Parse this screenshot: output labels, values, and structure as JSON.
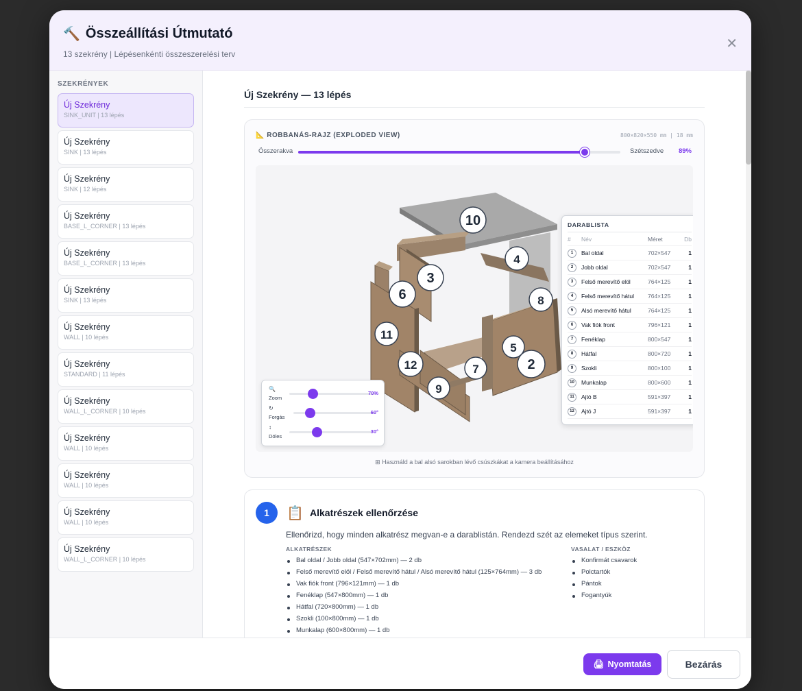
{
  "modal": {
    "title": "Összeállítási Útmutató",
    "subtitle": "13 szekrény | Lépésenkénti összeszerelési terv",
    "close_glyph": "✕"
  },
  "sidebar": {
    "title": "SZEKRÉNYEK",
    "items": [
      {
        "name": "Új Szekrény",
        "meta": "SINK_UNIT | 13 lépés"
      },
      {
        "name": "Új Szekrény",
        "meta": "SINK | 13 lépés"
      },
      {
        "name": "Új Szekrény",
        "meta": "SINK | 12 lépés"
      },
      {
        "name": "Új Szekrény",
        "meta": "BASE_L_CORNER | 13 lépés"
      },
      {
        "name": "Új Szekrény",
        "meta": "BASE_L_CORNER | 13 lépés"
      },
      {
        "name": "Új Szekrény",
        "meta": "SINK | 13 lépés"
      },
      {
        "name": "Új Szekrény",
        "meta": "WALL | 10 lépés"
      },
      {
        "name": "Új Szekrény",
        "meta": "STANDARD | 11 lépés"
      },
      {
        "name": "Új Szekrény",
        "meta": "WALL_L_CORNER | 10 lépés"
      },
      {
        "name": "Új Szekrény",
        "meta": "WALL | 10 lépés"
      },
      {
        "name": "Új Szekrény",
        "meta": "WALL | 10 lépés"
      },
      {
        "name": "Új Szekrény",
        "meta": "WALL | 10 lépés"
      },
      {
        "name": "Új Szekrény",
        "meta": "WALL_L_CORNER | 10 lépés"
      }
    ]
  },
  "main": {
    "heading": "Új Szekrény — 13 lépés",
    "viewer": {
      "title": "ROBBANÁS-RAJZ (EXPLODED VIEW)",
      "dims": "800×820×550 mm | 18 mm",
      "left_label": "Összerakva",
      "right_label": "Szétszedve",
      "explode_value": "89%",
      "explode_fraction": 0.89,
      "hint": "Használd a bal alsó sarokban lévő csúszkákat a kamera beállításához",
      "bom": {
        "title": "DARABLISTA",
        "headers": {
          "n": "#",
          "name": "Név",
          "size": "Méret",
          "qty": "Db"
        },
        "rows": [
          {
            "n": "1",
            "name": "Bal oldal",
            "size": "702×547",
            "qty": "1"
          },
          {
            "n": "2",
            "name": "Jobb oldal",
            "size": "702×547",
            "qty": "1"
          },
          {
            "n": "3",
            "name": "Felső merevítő elöl",
            "size": "764×125",
            "qty": "1"
          },
          {
            "n": "4",
            "name": "Felső merevítő hátul",
            "size": "764×125",
            "qty": "1"
          },
          {
            "n": "5",
            "name": "Alsó merevítő hátul",
            "size": "764×125",
            "qty": "1"
          },
          {
            "n": "6",
            "name": "Vak fiók front",
            "size": "796×121",
            "qty": "1"
          },
          {
            "n": "7",
            "name": "Fenéklap",
            "size": "800×547",
            "qty": "1"
          },
          {
            "n": "8",
            "name": "Hátfal",
            "size": "800×720",
            "qty": "1"
          },
          {
            "n": "9",
            "name": "Szokli",
            "size": "800×100",
            "qty": "1"
          },
          {
            "n": "10",
            "name": "Munkalap",
            "size": "800×600",
            "qty": "1"
          },
          {
            "n": "11",
            "name": "Ajtó B",
            "size": "591×397",
            "qty": "1"
          },
          {
            "n": "12",
            "name": "Ajtó J",
            "size": "591×397",
            "qty": "1"
          }
        ]
      },
      "camera": {
        "zoom": {
          "label": "Zoom",
          "value": "70%",
          "fraction": 0.27
        },
        "rotate": {
          "label": "Forgás",
          "value": "60°",
          "fraction": 0.2
        },
        "tilt": {
          "label": "Döles",
          "value": "30°",
          "fraction": 0.33
        }
      },
      "callouts": [
        "10",
        "4",
        "3",
        "6",
        "8",
        "11",
        "5",
        "2",
        "12",
        "7",
        "9"
      ]
    },
    "step": {
      "number": "1",
      "title": "Alkatrészek ellenőrzése",
      "description": "Ellenőrizd, hogy minden alkatrész megvan-e a darablistán. Rendezd szét az elemeket típus szerint.",
      "parts_heading": "ALKATRÉSZEK",
      "parts": [
        "Bal oldal / Jobb oldal (547×702mm) — 2 db",
        "Felső merevítő elöl / Felső merevítő hátul / Alsó merevítő hátul (125×764mm) — 3 db",
        "Vak fiók front (796×121mm) — 1 db",
        "Fenéklap (547×800mm) — 1 db",
        "Hátfal (720×800mm) — 1 db",
        "Szokli (100×800mm) — 1 db",
        "Munkalap (600×800mm) — 1 db"
      ],
      "tools_heading": "VASALAT / ESZKÖZ",
      "tools": [
        "Konfirmát csavarok",
        "Polctartók",
        "Pántok",
        "Fogantyúk"
      ]
    }
  },
  "footer": {
    "print_label": "Nyomtatás",
    "close_label": "Bezárás"
  }
}
